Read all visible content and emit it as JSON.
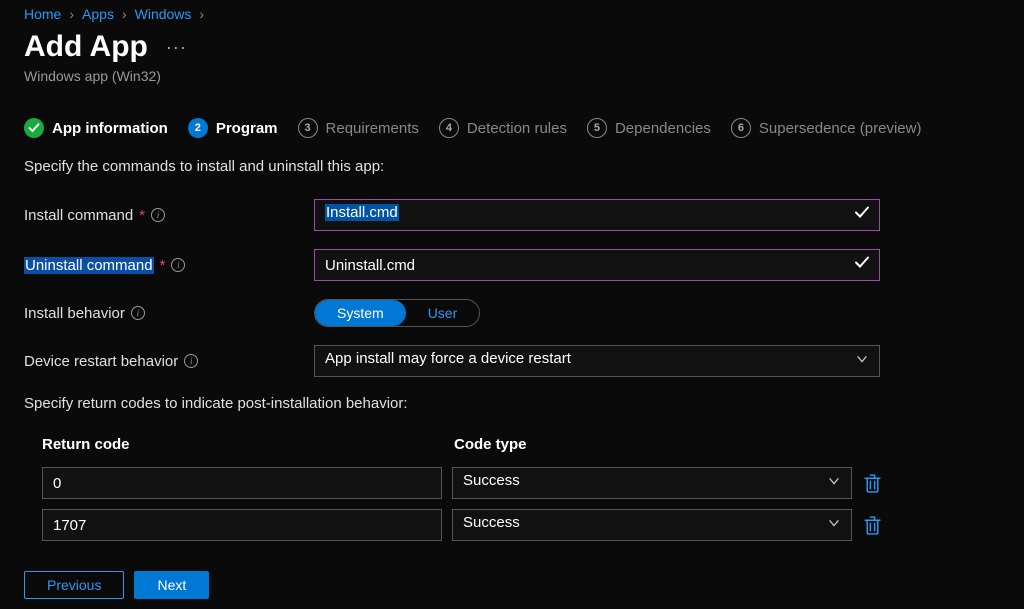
{
  "breadcrumb": {
    "items": [
      "Home",
      "Apps",
      "Windows"
    ]
  },
  "header": {
    "title": "Add App",
    "subtitle": "Windows app (Win32)"
  },
  "steps": [
    {
      "num": "✓",
      "label": "App information",
      "state": "complete"
    },
    {
      "num": "2",
      "label": "Program",
      "state": "current"
    },
    {
      "num": "3",
      "label": "Requirements",
      "state": "pending"
    },
    {
      "num": "4",
      "label": "Detection rules",
      "state": "pending"
    },
    {
      "num": "5",
      "label": "Dependencies",
      "state": "pending"
    },
    {
      "num": "6",
      "label": "Supersedence (preview)",
      "state": "pending"
    }
  ],
  "form": {
    "instruction1": "Specify the commands to install and uninstall this app:",
    "install_label": "Install command",
    "install_value": "Install.cmd",
    "uninstall_label": "Uninstall command",
    "uninstall_value": "Uninstall.cmd",
    "behavior_label": "Install behavior",
    "behavior_options": {
      "system": "System",
      "user": "User"
    },
    "restart_label": "Device restart behavior",
    "restart_value": "App install may force a device restart",
    "instruction2": "Specify return codes to indicate post-installation behavior:",
    "return_codes": {
      "header_return": "Return code",
      "header_type": "Code type",
      "rows": [
        {
          "code": "0",
          "type": "Success"
        },
        {
          "code": "1707",
          "type": "Success"
        }
      ]
    }
  },
  "footer": {
    "previous": "Previous",
    "next": "Next"
  }
}
